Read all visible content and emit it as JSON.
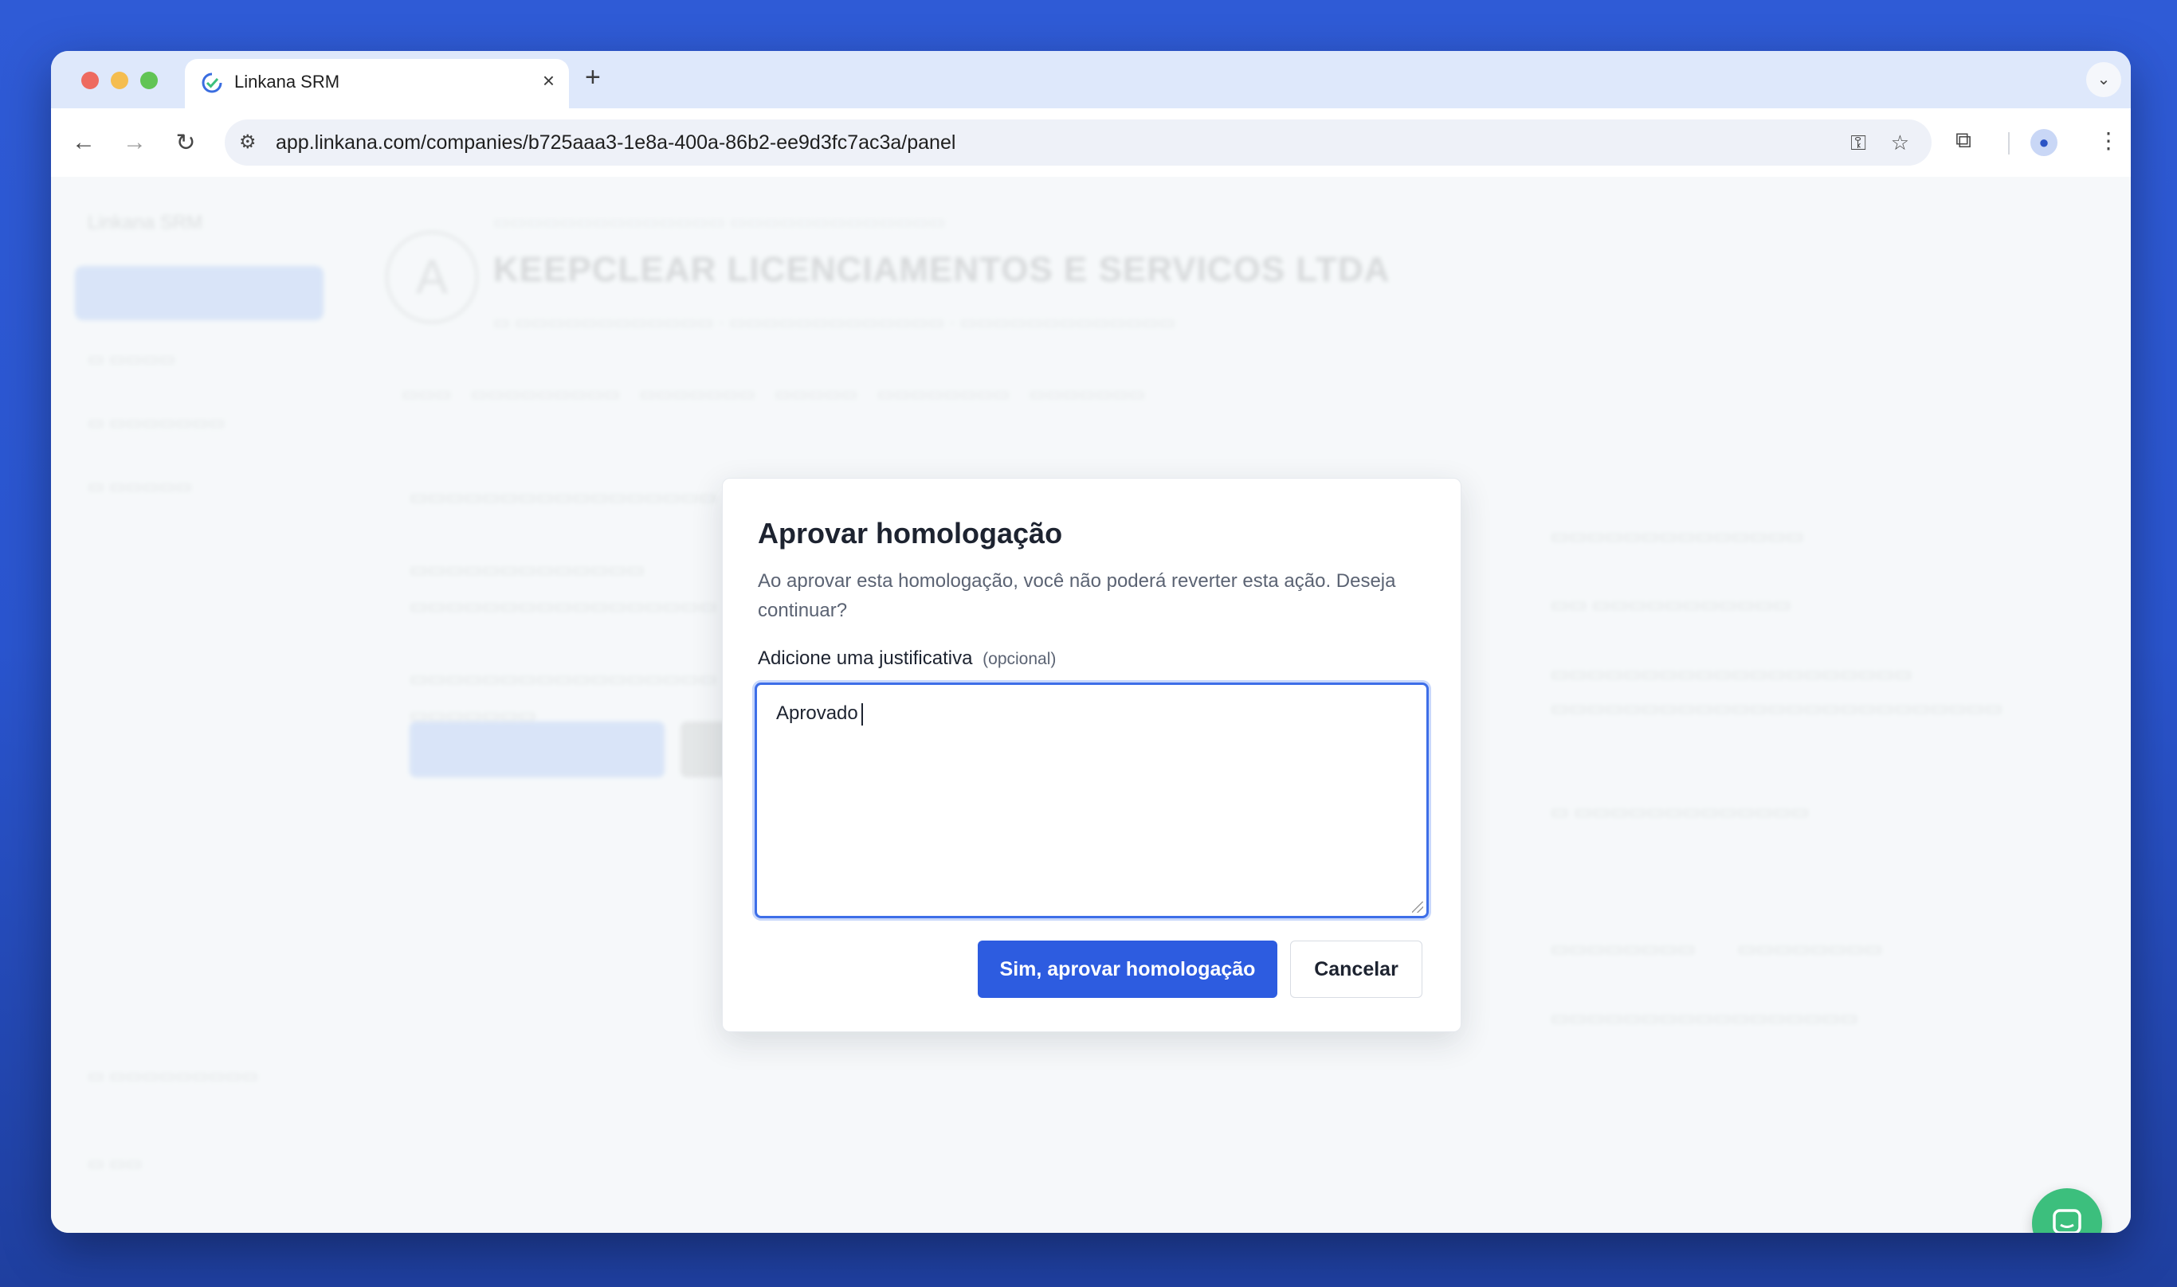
{
  "browser": {
    "tab_title": "Linkana SRM",
    "tab_close": "×",
    "new_tab": "+",
    "url": "app.linkana.com/companies/b725aaa3-1e8a-400a-86b2-ee9d3fc7ac3a/panel"
  },
  "background_page": {
    "brand": "Linkana SRM",
    "company_initial": "A",
    "company_name": "KEEPCLEAR LICENCIAMENTOS E SERVICOS LTDA"
  },
  "modal": {
    "title": "Aprovar homologação",
    "description": "Ao aprovar esta homologação, você não poderá reverter esta ação. Deseja continuar?",
    "field_label": "Adicione uma justificativa",
    "field_hint": "(opcional)",
    "textarea_value": "Aprovado",
    "confirm_label": "Sim, aprovar homologação",
    "cancel_label": "Cancelar"
  },
  "colors": {
    "primary": "#2d5ce0",
    "chat": "#3cbf7d",
    "background": "#2f5bd6"
  },
  "icons": [
    "back-icon",
    "forward-icon",
    "reload-icon",
    "site-info-icon",
    "key-icon",
    "star-icon",
    "extensions-icon",
    "profile-icon",
    "more-icon",
    "chat-icon"
  ]
}
